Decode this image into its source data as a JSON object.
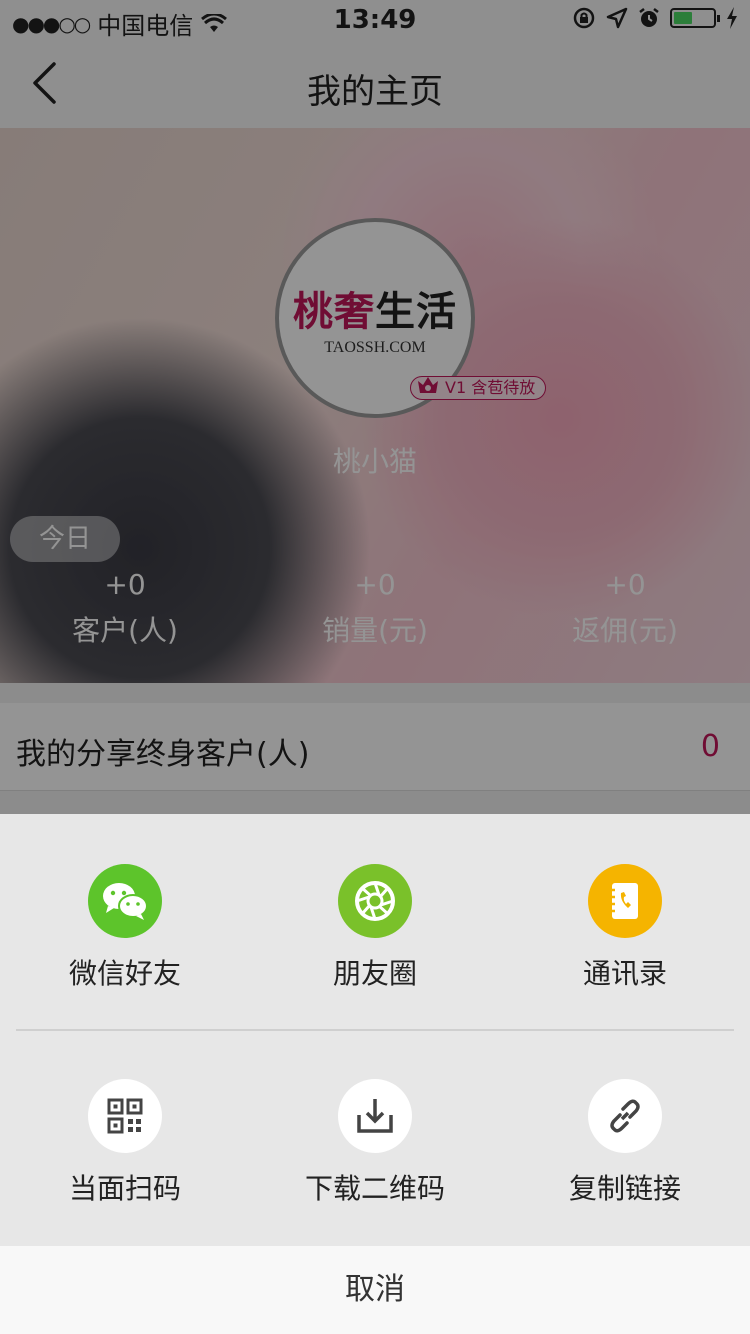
{
  "status_bar": {
    "signal": "●●●○○",
    "carrier": "中国电信",
    "time": "13:49"
  },
  "nav": {
    "title": "我的主页"
  },
  "profile": {
    "logo_main_pink": "桃奢",
    "logo_main_dark": "生活",
    "logo_sub": "TAOSSH.COM",
    "level": "V1 含苞待放",
    "username": "桃小猫"
  },
  "today": {
    "label": "今日",
    "stats": [
      {
        "value": "+0",
        "label": "客户(人)"
      },
      {
        "value": "+0",
        "label": "销量(元)"
      },
      {
        "value": "+0",
        "label": "返佣(元)"
      }
    ]
  },
  "lifetime": {
    "label": "我的分享终身客户(人)",
    "value": "0"
  },
  "share": {
    "items": [
      {
        "label": "微信好友",
        "icon": "wechat-icon",
        "color": "#5dc42b"
      },
      {
        "label": "朋友圈",
        "icon": "moments-icon",
        "color": "#7ac12a"
      },
      {
        "label": "通讯录",
        "icon": "contacts-icon",
        "color": "#f5b400"
      },
      {
        "label": "当面扫码",
        "icon": "qrcode-icon",
        "color": "#ffffff"
      },
      {
        "label": "下载二维码",
        "icon": "download-icon",
        "color": "#ffffff"
      },
      {
        "label": "复制链接",
        "icon": "link-icon",
        "color": "#ffffff"
      }
    ],
    "cancel": "取消"
  },
  "colors": {
    "accent": "#c2185b",
    "sheet_bg": "#e7e7e7"
  }
}
